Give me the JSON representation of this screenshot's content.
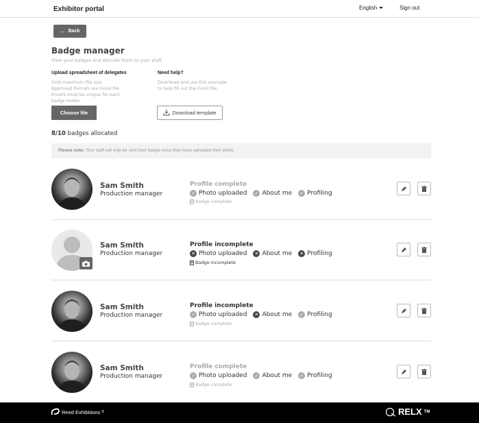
{
  "header": {
    "brand": "Exhibitor portal",
    "language": "English",
    "signout": "Sign out"
  },
  "back_label": "Back",
  "page": {
    "title": "Badge manager",
    "subtitle": "View your badges and allocate them to your staff"
  },
  "upload": {
    "heading": "Upload spreadsheet of delegates",
    "lines": [
      "5mb maximum file size",
      "Approved formats are Excel file",
      "Emails must be unique for each",
      "badge holder"
    ],
    "button": "Choose file"
  },
  "help": {
    "heading": "Need help?",
    "lines": [
      "Download and use this example",
      "to help fill out the Excel file"
    ],
    "button": "Download template"
  },
  "allocation": {
    "count": "8/10",
    "suffix": " badges allocated"
  },
  "note": {
    "label": "Please note:",
    "text": " Your staff will only be sent their badge once they have uploaded their photo"
  },
  "staff": [
    {
      "name": "Sam Smith",
      "role": "Production manager",
      "avatar": "photo",
      "status": "Profile complete",
      "status_color": "#aaaaaa",
      "checks": [
        {
          "label": "Photo uploaded",
          "ok": true
        },
        {
          "label": "About me",
          "ok": true
        },
        {
          "label": "Profiling",
          "ok": true
        }
      ],
      "badge": "Badge complete",
      "badge_color": "#aaaaaa"
    },
    {
      "name": "Sam Smith",
      "role": "Production manager",
      "avatar": "empty",
      "status": "Profile incomplete",
      "status_color": "#333333",
      "checks": [
        {
          "label": "Photo uploaded",
          "ok": false
        },
        {
          "label": "About me",
          "ok": false
        },
        {
          "label": "Profiling",
          "ok": false
        }
      ],
      "badge": "Badge incomplete",
      "badge_color": "#333333"
    },
    {
      "name": "Sam Smith",
      "role": "Production manager",
      "avatar": "photo",
      "status": "Profile incomplete",
      "status_color": "#333333",
      "checks": [
        {
          "label": "Photo uploaded",
          "ok": true
        },
        {
          "label": "About me",
          "ok": false
        },
        {
          "label": "Profiling",
          "ok": true
        }
      ],
      "badge": "Badge complete",
      "badge_color": "#aaaaaa"
    },
    {
      "name": "Sam Smith",
      "role": "Production manager",
      "avatar": "photo",
      "status": "Profile complete",
      "status_color": "#aaaaaa",
      "checks": [
        {
          "label": "Photo uploaded",
          "ok": true
        },
        {
          "label": "About me",
          "ok": true
        },
        {
          "label": "Profiling",
          "ok": true
        }
      ],
      "badge": "Badge complete",
      "badge_color": "#aaaaaa"
    }
  ],
  "footer": {
    "reed": "Reed Exhibitions",
    "reed_mark": "®",
    "relx": "RELX",
    "tm": "TM"
  }
}
